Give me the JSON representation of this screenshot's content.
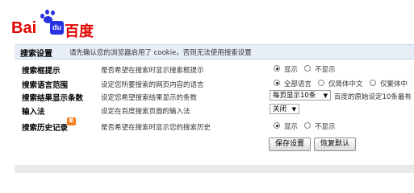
{
  "logo": {
    "bai": "Bai",
    "du": "du",
    "dude": "百度"
  },
  "header": {
    "title": "搜索设置",
    "notice": "请先确认您的浏览器启用了 cookie，否则无法使用搜索设置"
  },
  "rows": [
    {
      "label": "搜索框提示",
      "desc": "是否希望在搜索时显示搜索框提示",
      "options": [
        "显示",
        "不显示"
      ],
      "selected": 0
    },
    {
      "label": "搜索语言范围",
      "desc": "设定您所要搜索的网页内容的语言",
      "options": [
        "全部语言",
        "仅简体中文",
        "仅繁体中"
      ],
      "selected": 0
    },
    {
      "label": "搜索结果显示条数",
      "desc": "设定您希望搜索结果显示的条数",
      "select_value": "每页显示10条",
      "after_text": "百度的原始设定10条最有"
    },
    {
      "label": "输入法",
      "desc": "设定在百度搜索页面的输入法",
      "select_value": "关闭"
    },
    {
      "label": "搜索历史记录",
      "badge": "新",
      "desc": "是否希望在搜索时显示您的搜索历史",
      "options": [
        "显示",
        "不显示"
      ],
      "selected": 0
    }
  ],
  "buttons": {
    "save": "保存设置",
    "restore": "恢复默认"
  }
}
